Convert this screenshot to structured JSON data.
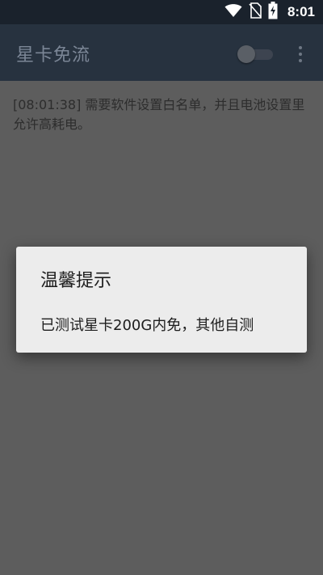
{
  "status_bar": {
    "time": "8:01",
    "icons": [
      "wifi-icon",
      "no-sim-icon",
      "battery-charging-icon"
    ]
  },
  "app_bar": {
    "title": "星卡免流",
    "toggle_state": "off"
  },
  "log": {
    "line": "[08:01:38] 需要软件设置白名单，并且电池设置里允许高耗电。"
  },
  "dialog": {
    "title": "温馨提示",
    "message": "已测试星卡200G内免，其他自测"
  },
  "colors": {
    "status_bar": "#1a222c",
    "app_bar": "#27323f",
    "title_text": "#7b8696",
    "background_dimmed": "#5d5d5d",
    "dialog_bg": "#ececec"
  }
}
